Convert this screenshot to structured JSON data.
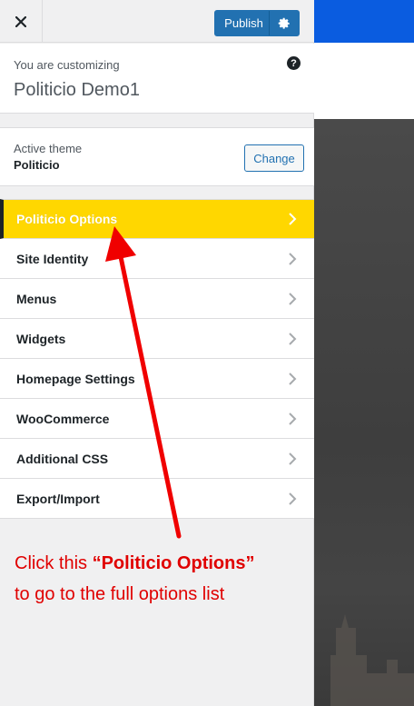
{
  "header": {
    "close_icon": "close-icon",
    "publish_label": "Publish",
    "settings_icon": "gear-icon"
  },
  "info": {
    "customizing_label": "You are customizing",
    "site_name": "Politicio Demo1",
    "help_icon": "?"
  },
  "theme": {
    "label": "Active theme",
    "name": "Politicio",
    "change_label": "Change"
  },
  "menu": {
    "items": [
      {
        "label": "Politicio Options",
        "active": true
      },
      {
        "label": "Site Identity"
      },
      {
        "label": "Menus"
      },
      {
        "label": "Widgets"
      },
      {
        "label": "Homepage Settings"
      },
      {
        "label": "WooCommerce"
      },
      {
        "label": "Additional CSS"
      },
      {
        "label": "Export/Import"
      }
    ]
  },
  "annotation": {
    "part1": "Click this ",
    "highlight": "“Politicio Options”",
    "part2": "to go to the full options list"
  },
  "colors": {
    "accent": "#2271b1",
    "active_item": "#ffd700",
    "annotation": "#e00000",
    "preview_bar": "#0a5ce0"
  }
}
